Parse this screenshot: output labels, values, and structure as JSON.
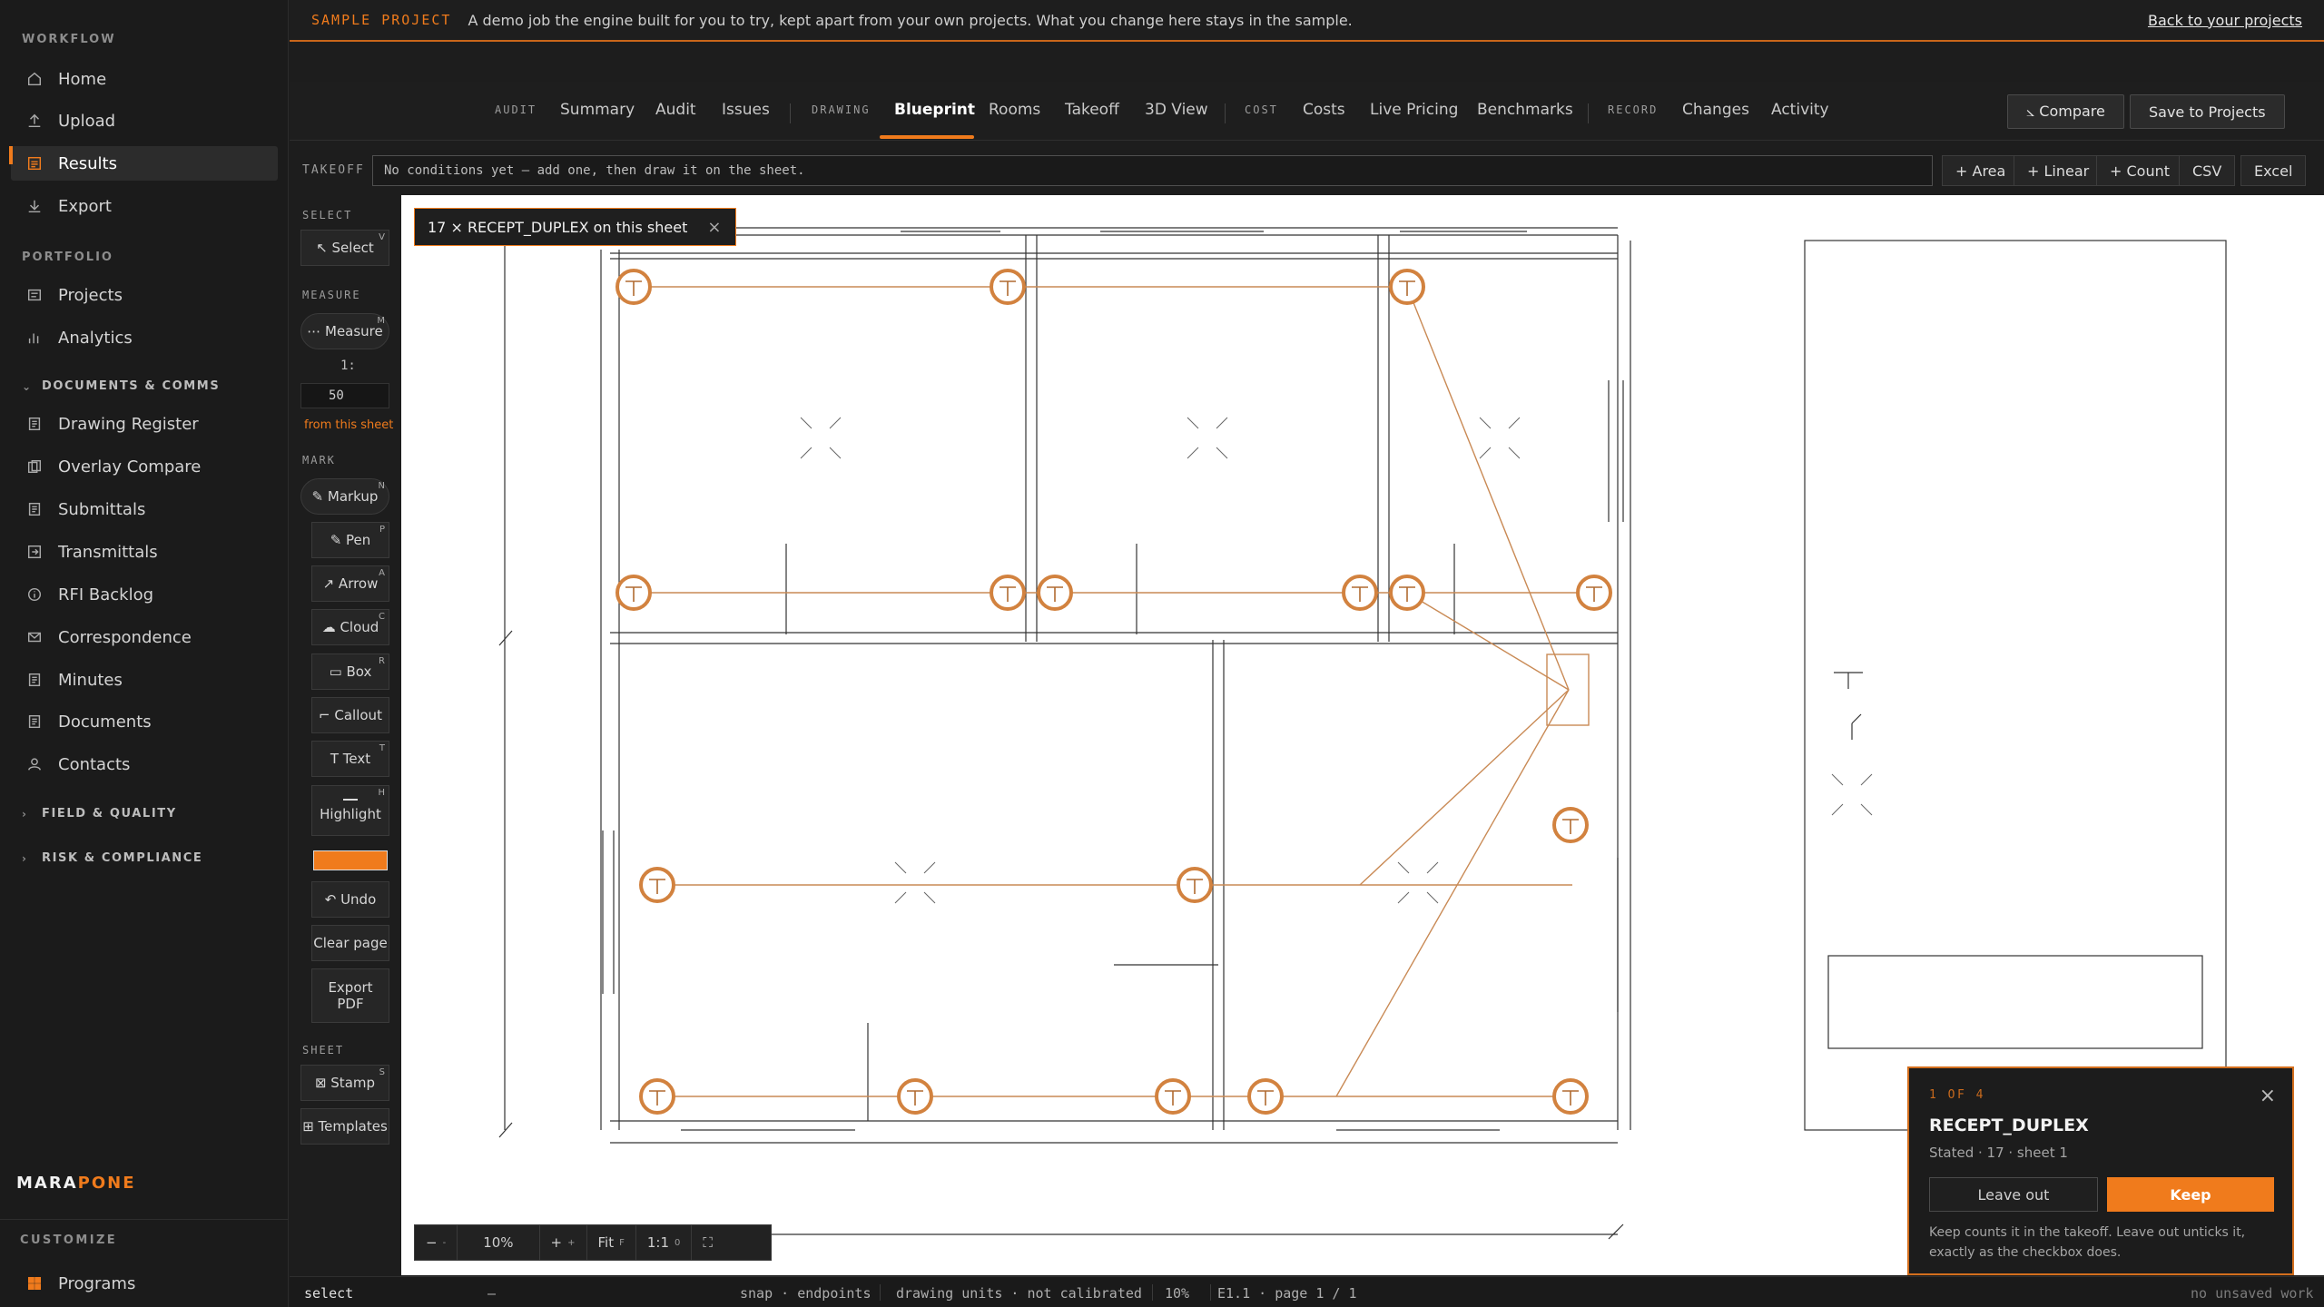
{
  "sidebar": {
    "workflow_label": "WORKFLOW",
    "workflow": [
      {
        "label": "Home",
        "icon": "home-icon"
      },
      {
        "label": "Upload",
        "icon": "upload-icon"
      },
      {
        "label": "Results",
        "icon": "results-icon",
        "active": true
      },
      {
        "label": "Export",
        "icon": "export-icon"
      }
    ],
    "portfolio_label": "PORTFOLIO",
    "portfolio": [
      {
        "label": "Projects",
        "icon": "projects-icon"
      },
      {
        "label": "Analytics",
        "icon": "analytics-icon"
      }
    ],
    "docs_group": "DOCUMENTS & COMMS",
    "docs": [
      {
        "label": "Drawing Register",
        "icon": "document-icon"
      },
      {
        "label": "Overlay Compare",
        "icon": "overlay-icon"
      },
      {
        "label": "Submittals",
        "icon": "document-icon"
      },
      {
        "label": "Transmittals",
        "icon": "transmittal-icon"
      },
      {
        "label": "RFI Backlog",
        "icon": "info-icon"
      },
      {
        "label": "Correspondence",
        "icon": "mail-icon"
      },
      {
        "label": "Minutes",
        "icon": "document-icon"
      },
      {
        "label": "Documents",
        "icon": "document-icon"
      },
      {
        "label": "Contacts",
        "icon": "person-icon"
      }
    ],
    "field_group": "FIELD & QUALITY",
    "risk_group": "RISK & COMPLIANCE",
    "brand_a": "MARA",
    "brand_b": "PONE",
    "customize_label": "CUSTOMIZE",
    "programs": "Programs"
  },
  "banner": {
    "tag": "SAMPLE PROJECT",
    "text": "A demo job the engine built for you to try, kept apart from your own projects. What you change here stays in the sample.",
    "link": "Back to your projects"
  },
  "nav": {
    "groups": {
      "audit": "AUDIT",
      "drawing": "DRAWING",
      "cost": "COST",
      "record": "RECORD"
    },
    "tabs": {
      "summary": "Summary",
      "audit": "Audit",
      "issues": "Issues",
      "blueprint": "Blueprint",
      "rooms": "Rooms",
      "takeoff": "Takeoff",
      "view3d": "3D View",
      "costs": "Costs",
      "live_pricing": "Live Pricing",
      "benchmarks": "Benchmarks",
      "changes": "Changes",
      "activity": "Activity"
    },
    "compare": "⦣ Compare",
    "save": "Save to Projects"
  },
  "takeoff": {
    "label": "TAKEOFF",
    "field": "No conditions yet — add one, then draw it on the sheet.",
    "area": "+ Area",
    "linear": "+ Linear",
    "count": "+ Count",
    "csv": "CSV",
    "excel": "Excel"
  },
  "tools": {
    "select_sec": "SELECT",
    "select": "↖ Select",
    "select_key": "V",
    "measure_sec": "MEASURE",
    "measure": "⋯ Measure",
    "measure_key": "M",
    "scale_prefix": "1:",
    "scale_value": "50",
    "scale_note": "from this sheet",
    "mark_sec": "MARK",
    "markup": "✎ Markup",
    "markup_key": "N",
    "pen": "✎ Pen",
    "pen_key": "P",
    "arrow": "↗ Arrow",
    "arrow_key": "A",
    "cloud": "☁ Cloud",
    "cloud_key": "C",
    "box": "▭ Box",
    "box_key": "R",
    "callout": "⌐ Callout",
    "text": "T Text",
    "text_key": "T",
    "highlight": "Highlight",
    "highlight_key": "H",
    "markup_color": "#f07b1c",
    "undo": "↶ Undo",
    "clear": "Clear page",
    "export": "Export PDF",
    "sheet_sec": "SHEET",
    "stamp": "⊠ Stamp",
    "stamp_key": "S",
    "templates": "⊞ Templates"
  },
  "canvas": {
    "chip": "17 × RECEPT_DUPLEX on this sheet",
    "zoom": {
      "minus": "−",
      "minus_key": "-",
      "level": "10%",
      "plus": "+",
      "plus_key": "+",
      "fit": "Fit",
      "fit_key": "F",
      "one": "1:1",
      "one_key": "0"
    }
  },
  "status": {
    "mode": "select",
    "dash": "—",
    "snap": "snap · endpoints",
    "units": "drawing units · not calibrated",
    "zoom": "10%",
    "sheet": "E1.1 · page 1 / 1",
    "save": "no unsaved work"
  },
  "popup": {
    "count": "1 OF 4",
    "title": "RECEPT_DUPLEX",
    "meta": "Stated · 17 · sheet 1",
    "leave": "Leave out",
    "keep": "Keep",
    "help": "Keep counts it in the takeoff. Leave out unticks it, exactly as the checkbox does."
  }
}
